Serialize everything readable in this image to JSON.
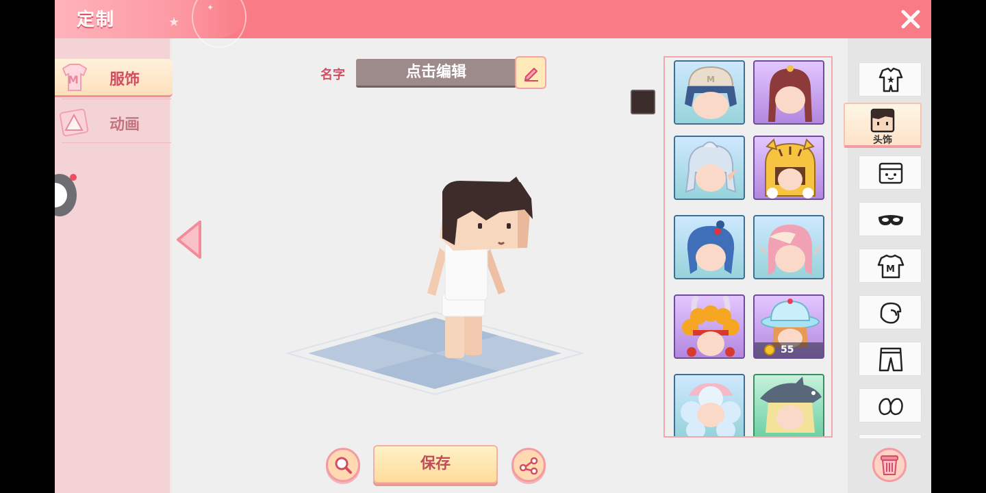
{
  "header": {
    "title": "定制",
    "close_icon": "close-icon"
  },
  "left_tabs": [
    {
      "label": "服饰",
      "icon": "shirt-m-icon",
      "active": true
    },
    {
      "label": "动画",
      "icon": "triangle-icon",
      "active": false
    }
  ],
  "name": {
    "label": "名字",
    "value": "点击编辑",
    "edit_icon": "pencil-icon"
  },
  "color": {
    "swatch": "#3a2c2a"
  },
  "actions": {
    "save_label": "保存",
    "zoom_icon": "magnifier-icon",
    "share_icon": "share-icon",
    "delete_icon": "trash-icon"
  },
  "items": [
    {
      "name": "beanie-hair",
      "rarity": "blue",
      "price": ""
    },
    {
      "name": "braided-red-hair",
      "rarity": "purple",
      "price": ""
    },
    {
      "name": "silver-elf-hair",
      "rarity": "blue",
      "price": ""
    },
    {
      "name": "tiger-hood",
      "rarity": "purple",
      "price": ""
    },
    {
      "name": "blue-bun-hair",
      "rarity": "blue",
      "price": ""
    },
    {
      "name": "pink-elf-hair",
      "rarity": "blue",
      "price": ""
    },
    {
      "name": "opera-headdress",
      "rarity": "purple",
      "price": ""
    },
    {
      "name": "cake-hat",
      "rarity": "purple",
      "price": "55"
    },
    {
      "name": "cloud-hair",
      "rarity": "blue",
      "price": ""
    },
    {
      "name": "shark-hat",
      "rarity": "green",
      "price": ""
    }
  ],
  "categories": [
    {
      "icon": "onesie-icon",
      "label": "",
      "active": false
    },
    {
      "icon": "head-icon",
      "label": "头饰",
      "active": true
    },
    {
      "icon": "face-icon",
      "label": "",
      "active": false
    },
    {
      "icon": "mask-icon",
      "label": "",
      "active": false
    },
    {
      "icon": "tshirt-icon",
      "label": "",
      "active": false
    },
    {
      "icon": "glove-icon",
      "label": "",
      "active": false
    },
    {
      "icon": "pants-icon",
      "label": "",
      "active": false
    },
    {
      "icon": "shoes-icon",
      "label": "",
      "active": false
    }
  ],
  "colors": {
    "header": "#f97b85",
    "accent_text": "#d14d62",
    "panel_bg": "#f4d3d6",
    "name_field": "#9d8a8b"
  }
}
